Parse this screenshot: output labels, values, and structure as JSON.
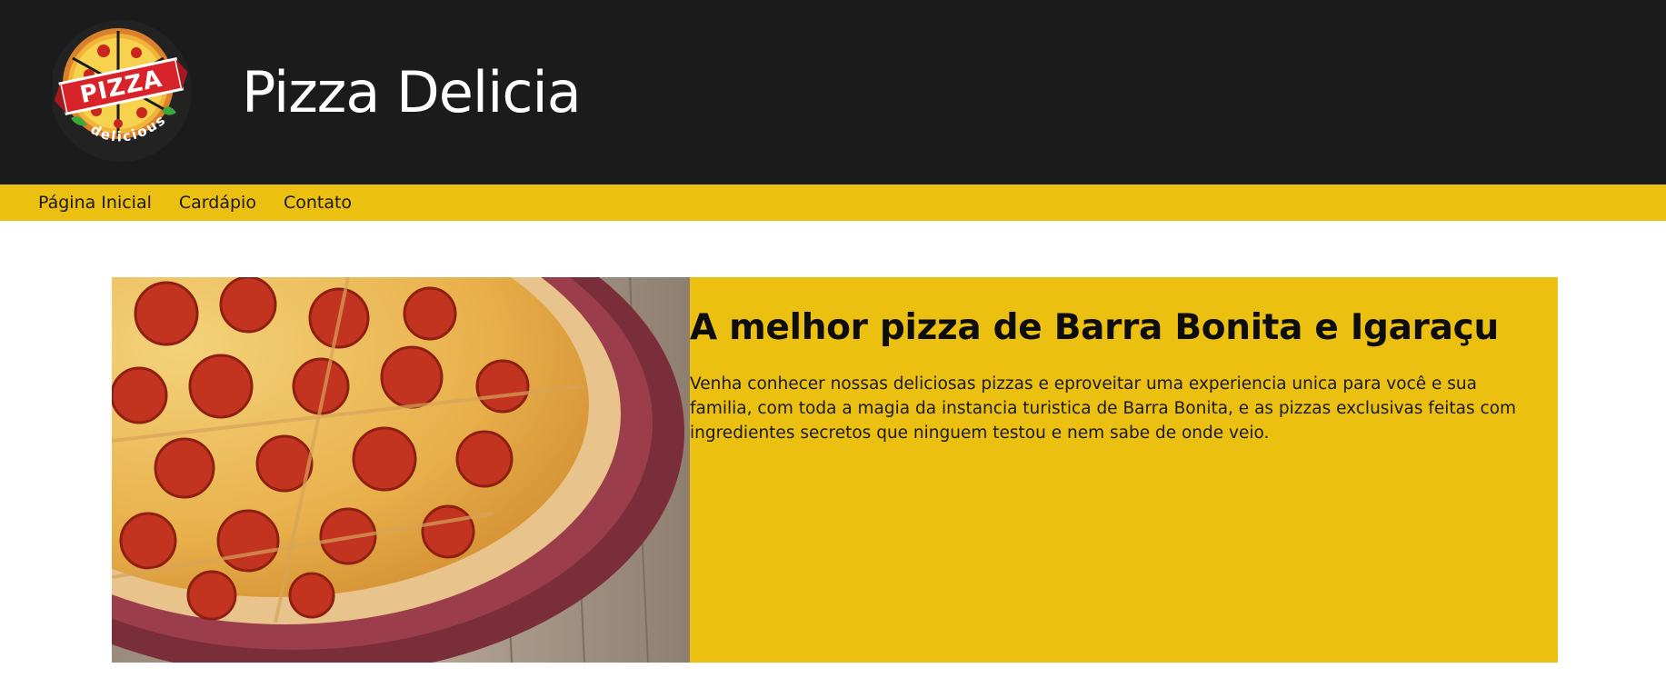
{
  "header": {
    "title": "Pizza Delicia",
    "logo": {
      "icon": "pizza-logo",
      "banner_text": "PIZZA",
      "tagline_text": "delicious"
    }
  },
  "nav": {
    "items": [
      {
        "label": "Página Inicial"
      },
      {
        "label": "Cardápio"
      },
      {
        "label": "Contato"
      }
    ]
  },
  "hero": {
    "image": "pepperoni-pizza-photo",
    "heading": "A melhor pizza de Barra Bonita e Igaraçu",
    "paragraph": "Venha conhecer nossas deliciosas pizzas e eproveitar uma experiencia unica para você e sua familia, com toda a magia da instancia turistica de Barra Bonita, e as pizzas exclusivas feitas com ingredientes secretos que ninguem testou e nem sabe de onde veio."
  },
  "colors": {
    "header_bg": "#1b1b1b",
    "accent": "#ebc010",
    "text_dark": "#1a1a1a"
  }
}
